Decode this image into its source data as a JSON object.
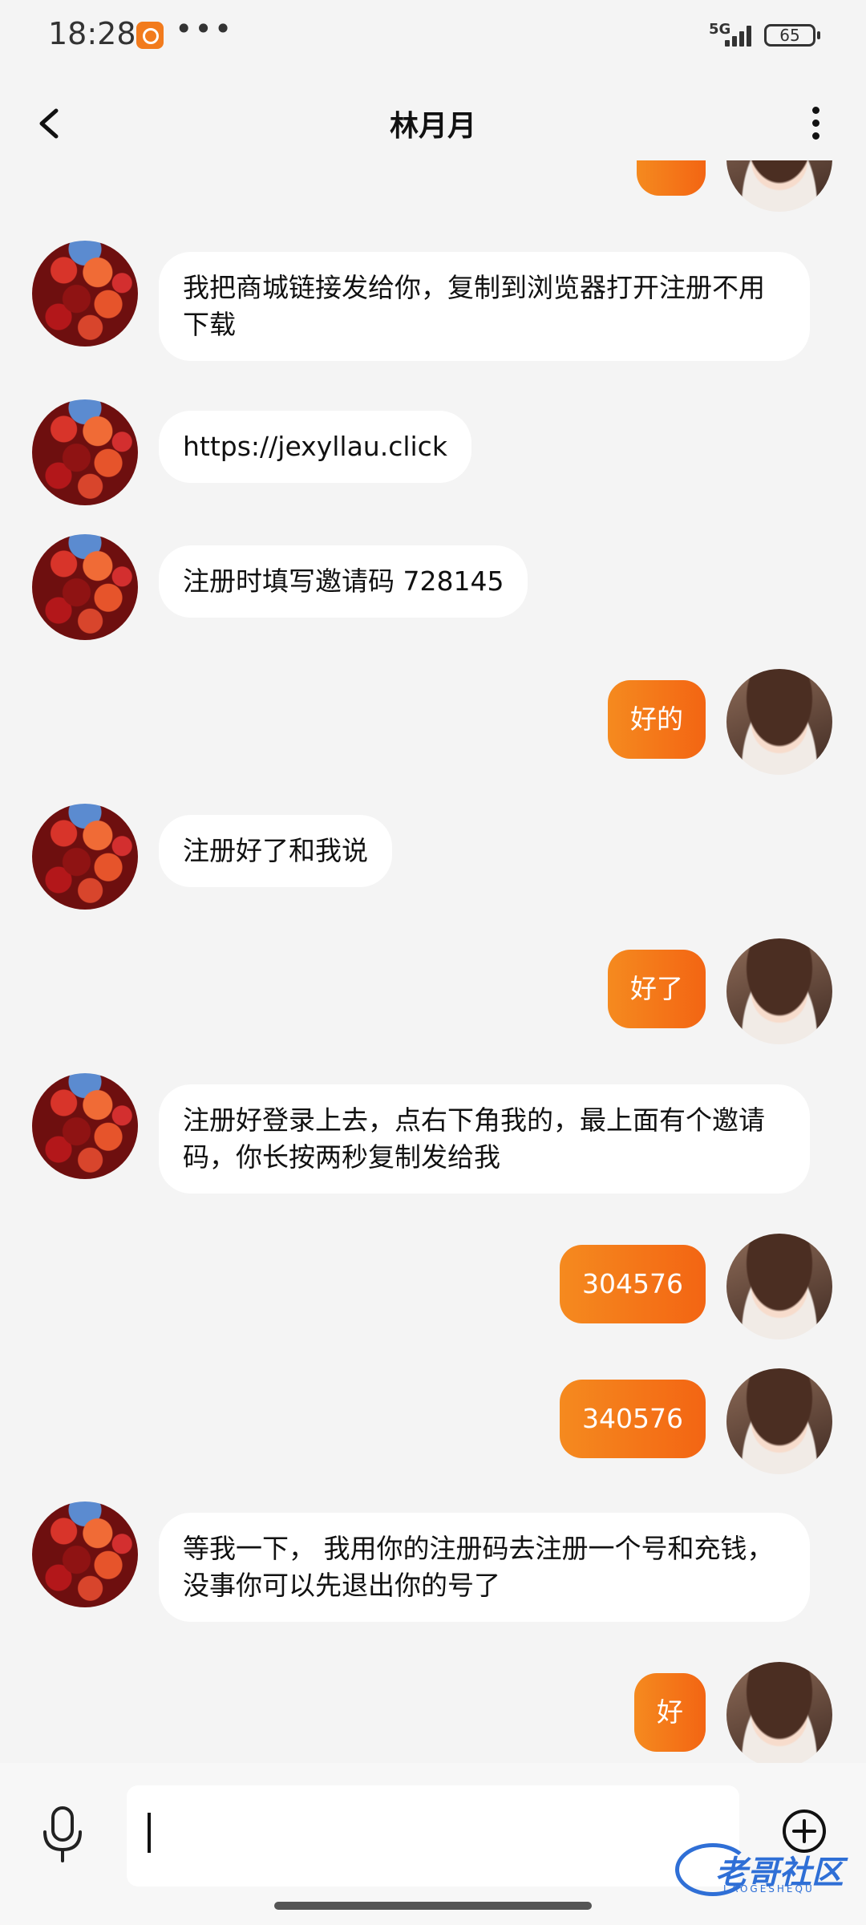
{
  "status_bar": {
    "time": "18:28",
    "more": "•••",
    "network": "5G",
    "battery": "65"
  },
  "header": {
    "title": "林月月"
  },
  "messages": [
    {
      "from": "contact",
      "text": "我把商城链接发给你，复制到浏览器打开注册不用下载"
    },
    {
      "from": "contact",
      "text": "https://jexyllau.click"
    },
    {
      "from": "contact",
      "text": "注册时填写邀请码 728145"
    },
    {
      "from": "self",
      "text": "好的"
    },
    {
      "from": "contact",
      "text": "注册好了和我说"
    },
    {
      "from": "self",
      "text": "好了"
    },
    {
      "from": "contact",
      "text": "注册好登录上去，点右下角我的，最上面有个邀请码，你长按两秒复制发给我"
    },
    {
      "from": "self",
      "text": "304576"
    },
    {
      "from": "self",
      "text": "340576"
    },
    {
      "from": "contact",
      "text": "等我一下，  我用你的注册码去注册一个号和充钱，没事你可以先退出你的号了"
    },
    {
      "from": "self",
      "text": "好"
    }
  ],
  "input_bar": {
    "value": ""
  },
  "watermark": {
    "text": "老哥社区",
    "sub": "LAOGESHEQU"
  },
  "colors": {
    "outgoing_bubble": "#f36f17",
    "incoming_bubble": "#ffffff",
    "background": "#f4f4f4"
  }
}
